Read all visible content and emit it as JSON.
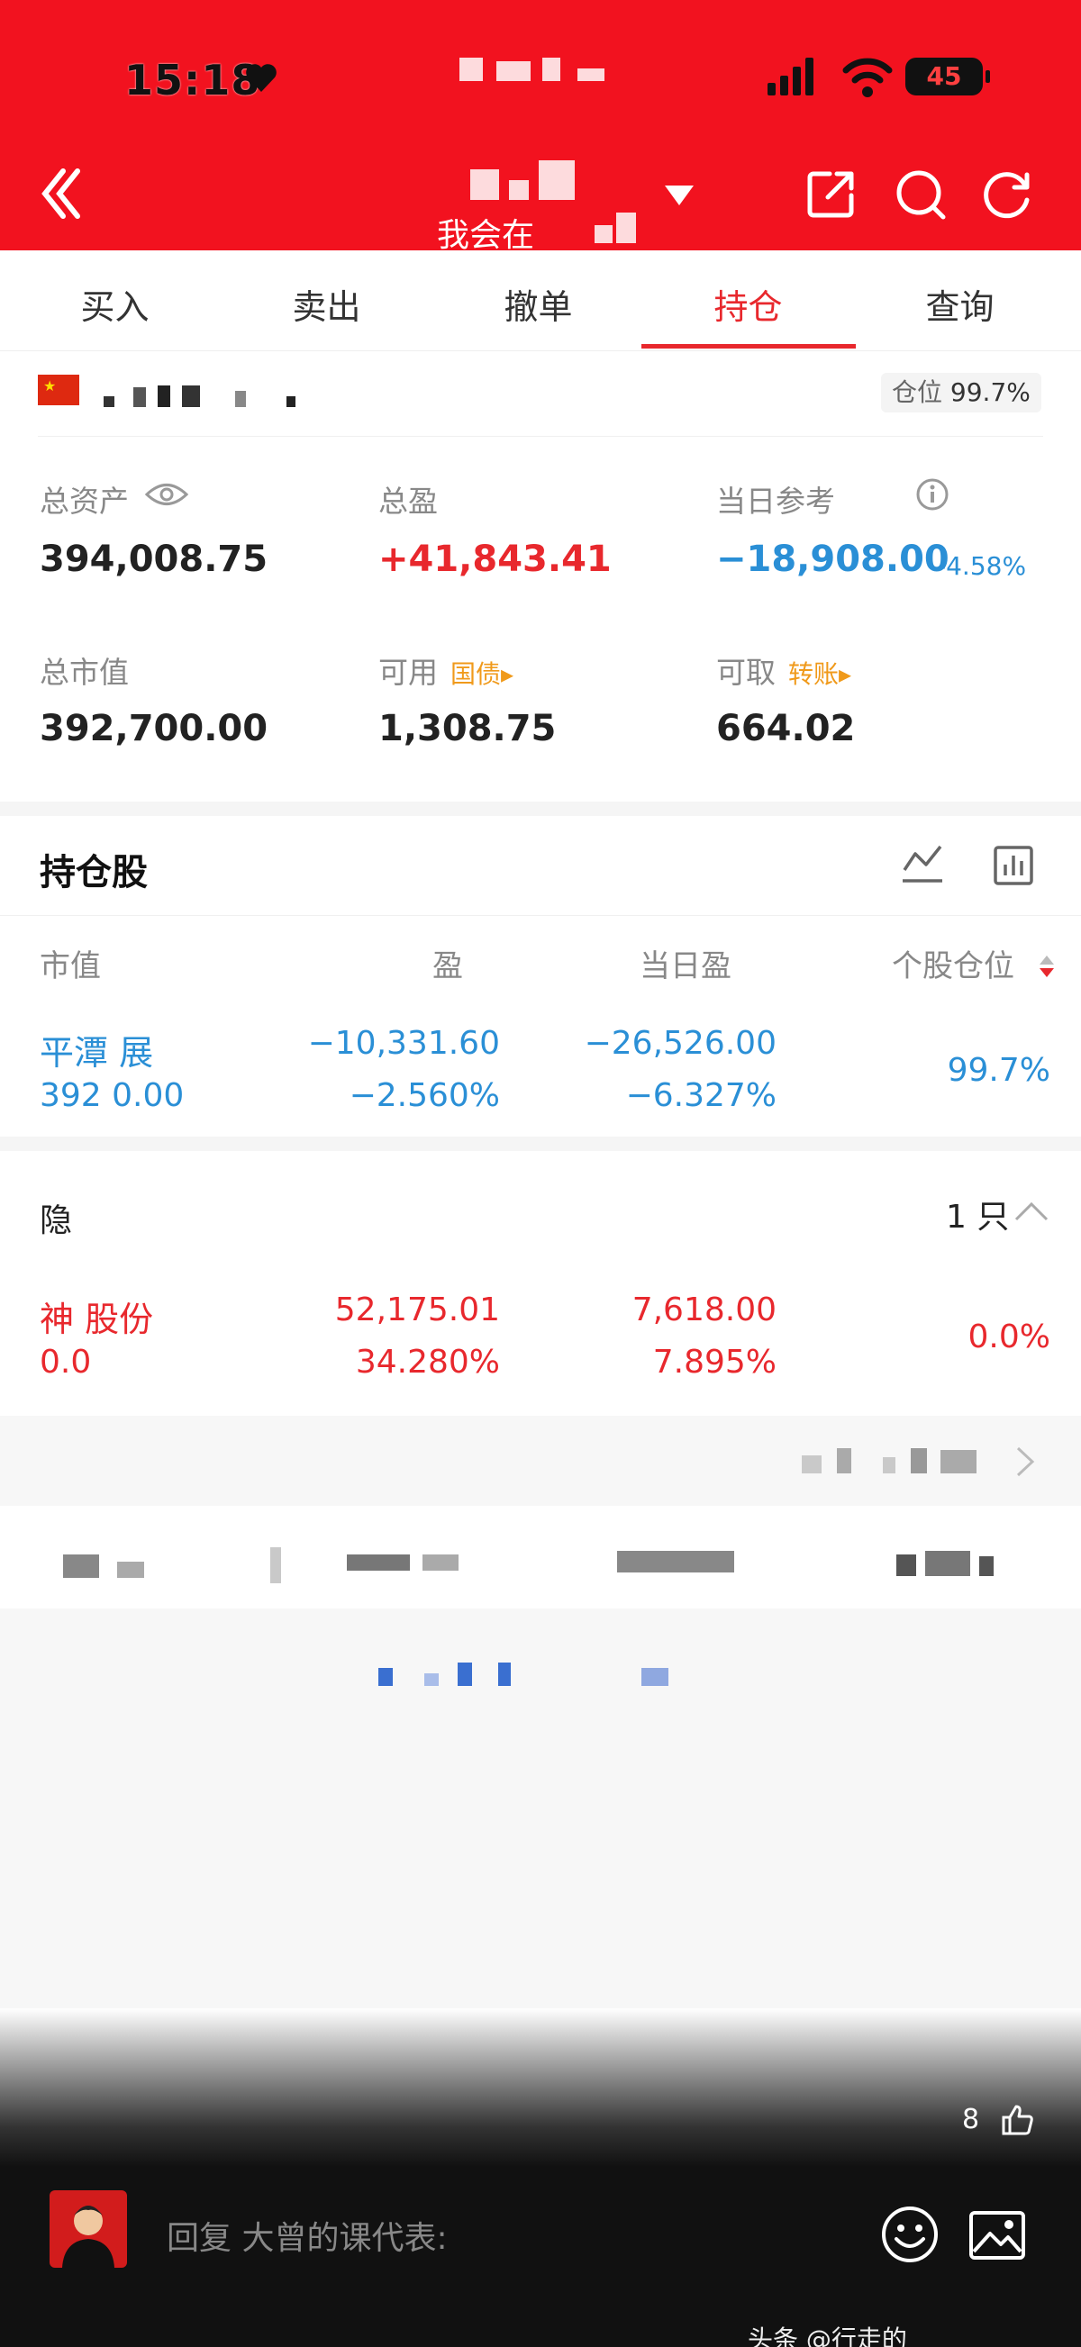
{
  "status_bar": {
    "time": "15:18",
    "battery": "45"
  },
  "header": {
    "subtitle": "我会在"
  },
  "tabs": [
    {
      "label": "买入"
    },
    {
      "label": "卖出"
    },
    {
      "label": "撤单"
    },
    {
      "label": "持仓"
    },
    {
      "label": "查询"
    }
  ],
  "active_tab": "持仓",
  "account": {
    "position_label": "仓位",
    "position_value": "99.7%",
    "total_assets_label": "总资产",
    "total_assets": "394,008.75",
    "total_pl_label": "总盈",
    "total_pl": "+41,843.41",
    "today_ref_label": "当日参考",
    "today_ref": "−18,908.00",
    "today_ref_pct": "-4.58%",
    "market_value_label": "总市值",
    "market_value": "392,700.00",
    "available_label": "可用",
    "available_link": "国债",
    "available": "1,308.75",
    "withdrawable_label": "可取",
    "withdrawable_link": "转账",
    "withdrawable": "664.02"
  },
  "holdings": {
    "title": "持仓股",
    "columns": {
      "market_value": "市值",
      "pl": "盈",
      "today_pl": "当日盈",
      "weight": "个股仓位"
    },
    "rows": [
      {
        "name": "平潭 展",
        "market_value": "392 0.00",
        "pl": "−10,331.60",
        "pl_pct": "−2.560%",
        "today_pl": "−26,526.00",
        "today_pl_pct": "−6.327%",
        "weight": "99.7%"
      }
    ],
    "hidden_label": "隐",
    "hidden_count": "1 只",
    "hidden_rows": [
      {
        "name": "神 股份",
        "market_value": "0.0",
        "pl": "52,175.01",
        "pl_pct": "34.280%",
        "today_pl": "7,618.00",
        "today_pl_pct": "7.895%",
        "weight": "0.0%"
      }
    ]
  },
  "comment_bar": {
    "likes": "8",
    "reply_placeholder": "回复 大曾的课代表:",
    "watermark": "头条 @行走的"
  },
  "colors": {
    "brand_red": "#f2121f",
    "up_red": "#e8282d",
    "down_blue": "#2a8fd6",
    "link_orange": "#f09a1b"
  }
}
